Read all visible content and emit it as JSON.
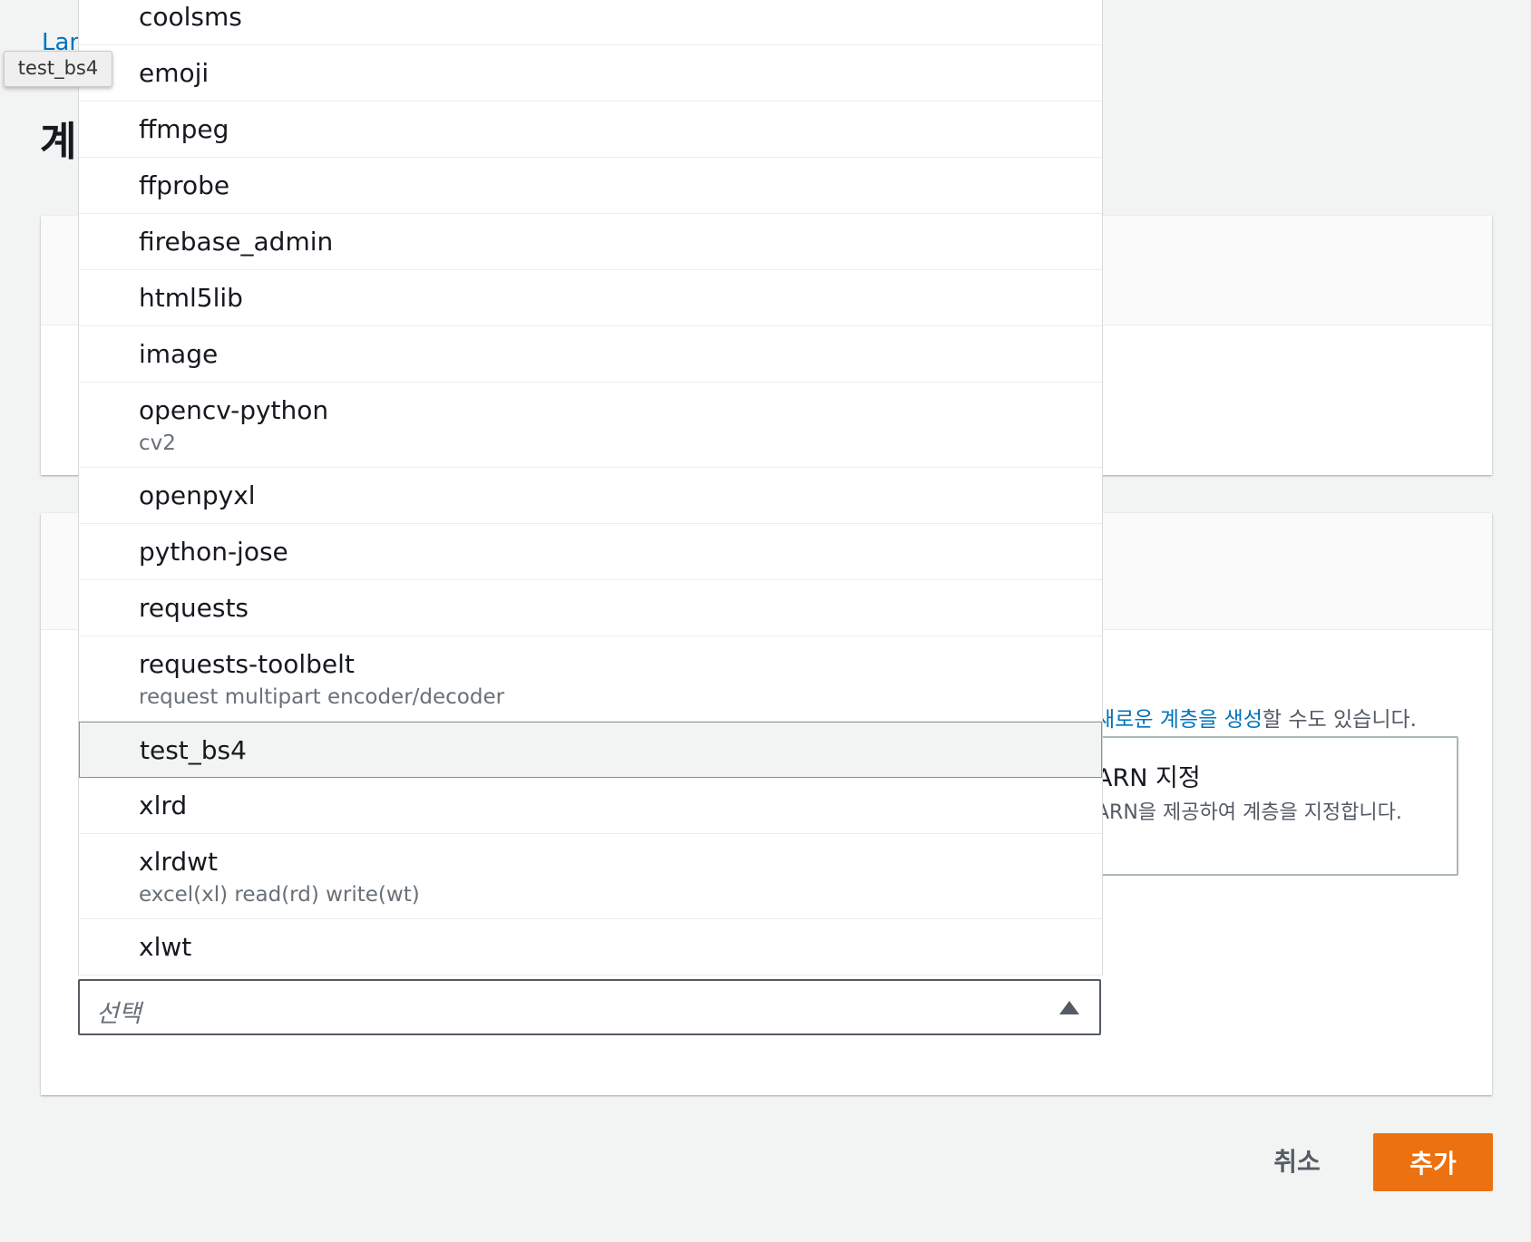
{
  "breadcrumb": "Lambda",
  "page_title": "계층 추가",
  "tooltip": "test_bs4",
  "layer_hint": {
    "link_text": "새로운 계층을 생성",
    "suffix": "할 수도 있습니다."
  },
  "arn_tile": {
    "title": "ARN 지정",
    "description": "ARN을 제공하여 계층을 지정합니다."
  },
  "select": {
    "placeholder": "선택"
  },
  "options": [
    {
      "label": "coolsms",
      "desc": ""
    },
    {
      "label": "emoji",
      "desc": ""
    },
    {
      "label": "ffmpeg",
      "desc": ""
    },
    {
      "label": "ffprobe",
      "desc": ""
    },
    {
      "label": "firebase_admin",
      "desc": ""
    },
    {
      "label": "html5lib",
      "desc": ""
    },
    {
      "label": "image",
      "desc": ""
    },
    {
      "label": "opencv-python",
      "desc": "cv2"
    },
    {
      "label": "openpyxl",
      "desc": ""
    },
    {
      "label": "python-jose",
      "desc": ""
    },
    {
      "label": "requests",
      "desc": ""
    },
    {
      "label": "requests-toolbelt",
      "desc": "request multipart encoder/decoder"
    },
    {
      "label": "test_bs4",
      "desc": "",
      "selected": true
    },
    {
      "label": "xlrd",
      "desc": ""
    },
    {
      "label": "xlrdwt",
      "desc": "excel(xl) read(rd) write(wt)"
    },
    {
      "label": "xlwt",
      "desc": ""
    }
  ],
  "buttons": {
    "cancel": "취소",
    "add": "추가"
  },
  "colors": {
    "accent": "#ec7211",
    "link": "#0073bb"
  }
}
